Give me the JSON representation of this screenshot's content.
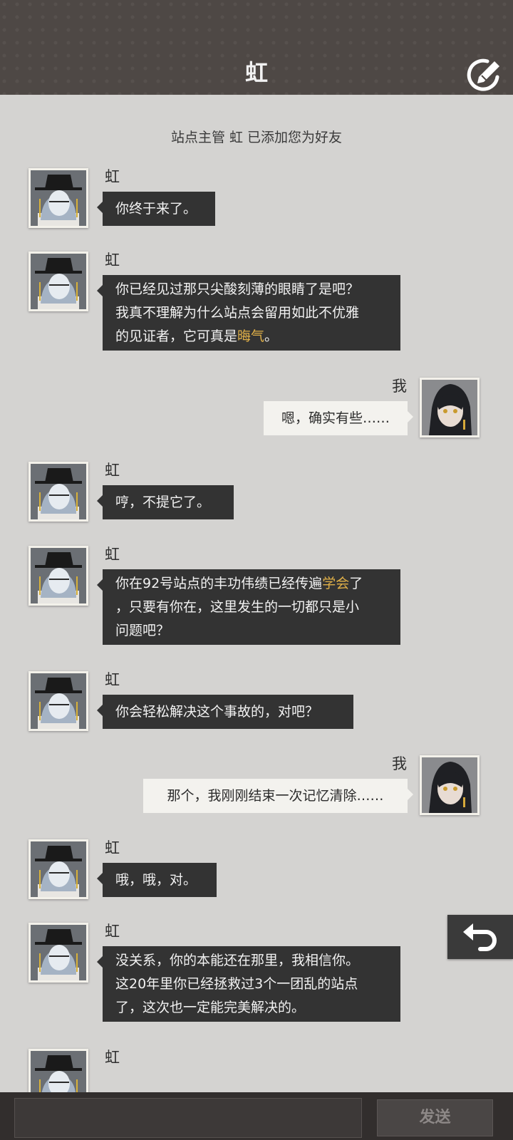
{
  "header": {
    "title": "虹"
  },
  "system_notice": "站点主管 虹 已添加您为好友",
  "messages": [
    {
      "sender": "虹",
      "side": "left",
      "segments": [
        {
          "text": "你终于来了。"
        }
      ]
    },
    {
      "sender": "虹",
      "side": "left",
      "segments": [
        {
          "text": "你已经见过那只尖酸刻薄的眼睛了是吧？我真不理解为什么站点会留用如此不优雅的见证者，它可真是"
        },
        {
          "text": "晦气",
          "highlight": true
        },
        {
          "text": "。"
        }
      ]
    },
    {
      "sender": "我",
      "side": "right",
      "segments": [
        {
          "text": "嗯，确实有些……"
        }
      ]
    },
    {
      "sender": "虹",
      "side": "left",
      "segments": [
        {
          "text": "哼，不提它了。"
        }
      ]
    },
    {
      "sender": "虹",
      "side": "left",
      "segments": [
        {
          "text": "你在92号站点的丰功伟绩已经传遍"
        },
        {
          "text": "学会",
          "highlight": true
        },
        {
          "text": "了，只要有你在，这里发生的一切都只是小问题吧？"
        }
      ]
    },
    {
      "sender": "虹",
      "side": "left",
      "segments": [
        {
          "text": "你会轻松解决这个事故的，对吧？"
        }
      ]
    },
    {
      "sender": "我",
      "side": "right",
      "segments": [
        {
          "text": "那个，我刚刚结束一次记忆清除……"
        }
      ]
    },
    {
      "sender": "虹",
      "side": "left",
      "segments": [
        {
          "text": "哦，哦，对。"
        }
      ]
    },
    {
      "sender": "虹",
      "side": "left",
      "segments": [
        {
          "text": "没关系，你的本能还在那里，我相信你。这20年里你已经拯救过3个一团乱的站点了，这次也一定能完美解决的。"
        }
      ]
    },
    {
      "sender": "虹",
      "side": "left",
      "segments": []
    }
  ],
  "footer": {
    "input_placeholder": "",
    "send_label": "发送"
  },
  "icons": {
    "edit": "edit-pen-icon",
    "back": "undo-arrow-icon"
  },
  "colors": {
    "header_bg": "#4e4845",
    "left_bubble": "#333333",
    "right_bubble": "#f3f2ee",
    "highlight": "#e0b048"
  }
}
